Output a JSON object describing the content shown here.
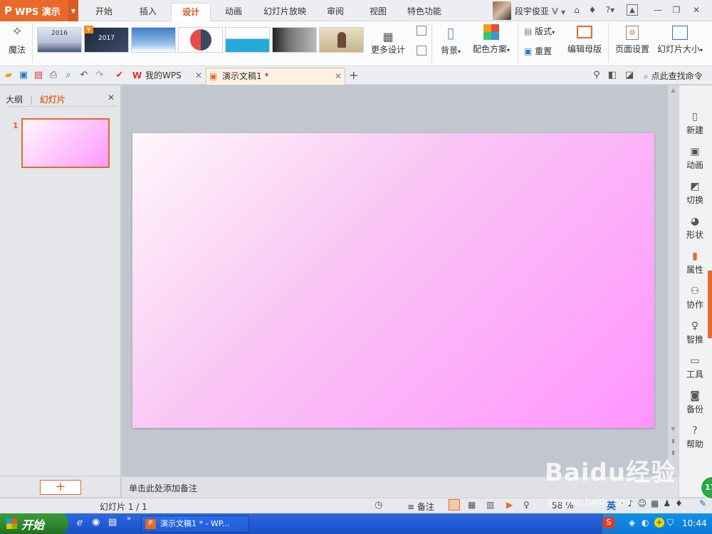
{
  "app": {
    "logo": "WPS 演示"
  },
  "menu_tabs": [
    {
      "label": "开始"
    },
    {
      "label": "插入"
    },
    {
      "label": "设计"
    },
    {
      "label": "动画"
    },
    {
      "label": "幻灯片放映"
    },
    {
      "label": "审阅"
    },
    {
      "label": "视图"
    },
    {
      "label": "特色功能"
    }
  ],
  "user": {
    "name": "段宇俊亚",
    "vip": "V"
  },
  "ribbon": {
    "magic": "魔法",
    "more_design": "更多设计",
    "background": "背景",
    "color_scheme": "配色方案",
    "layout": "版式",
    "reset": "重置",
    "edit_master": "编辑母版",
    "page_setup": "页面设置",
    "slide_size": "幻灯片大小",
    "theme_years": [
      "2016",
      "2017"
    ],
    "badge": "¥"
  },
  "doc_tabs": {
    "home": "我的WPS",
    "doc": "演示文稿1 *",
    "search": "点此查找命令"
  },
  "left_panel": {
    "outline": "大纲",
    "slides": "幻灯片",
    "slide_number": "1",
    "add": "+"
  },
  "notes": {
    "placeholder": "单击此处添加备注"
  },
  "right_panel": [
    {
      "icon": "new-icon",
      "label": "新建"
    },
    {
      "icon": "animation-icon",
      "label": "动画"
    },
    {
      "icon": "transition-icon",
      "label": "切换"
    },
    {
      "icon": "shape-icon",
      "label": "形状"
    },
    {
      "icon": "property-icon",
      "label": "属性"
    },
    {
      "icon": "collab-icon",
      "label": "协作"
    },
    {
      "icon": "recommend-icon",
      "label": "智推"
    },
    {
      "icon": "tools-icon",
      "label": "工具"
    },
    {
      "icon": "backup-icon",
      "label": "备份"
    },
    {
      "icon": "help-icon",
      "label": "帮助"
    }
  ],
  "status": {
    "slide_info": "幻灯片 1 / 1",
    "notes": "备注",
    "zoom": "58 %"
  },
  "taskbar": {
    "start": "开始",
    "window": "演示文稿1 * - WP...",
    "clock": "10:44",
    "ime": "英"
  },
  "watermark": {
    "brand": "Baidu经验",
    "url": "jingyan.baidu.com",
    "badge": "17"
  },
  "colors": {
    "accent": "#e8692a",
    "slide_grad_start": "#fff7fb",
    "slide_grad_end": "#ff95ff"
  }
}
